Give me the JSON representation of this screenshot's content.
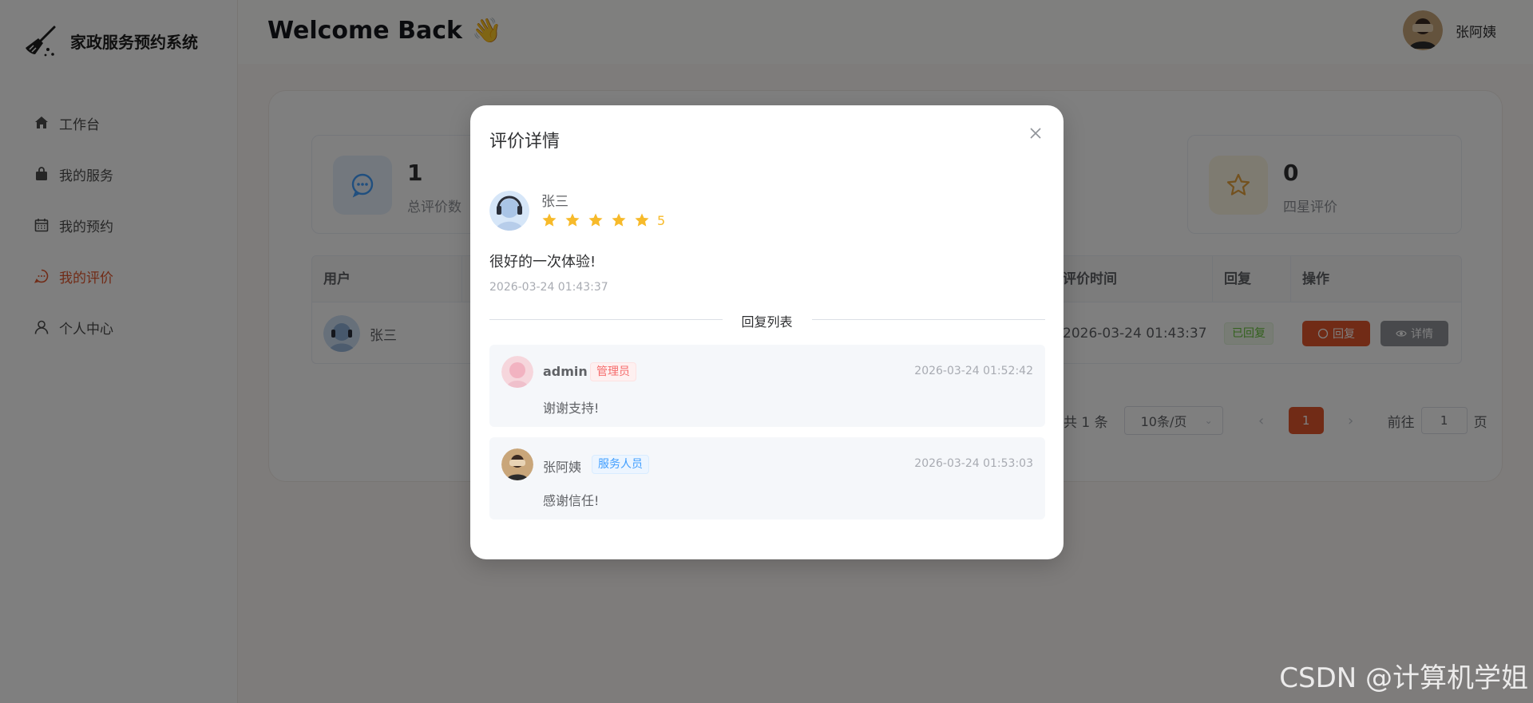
{
  "app": {
    "title": "家政服务预约系统",
    "logo_icon": "broom-icon"
  },
  "sidebar": {
    "items": [
      {
        "label": "工作台",
        "icon": "home-icon",
        "active": false
      },
      {
        "label": "我的服务",
        "icon": "bag-icon",
        "active": false
      },
      {
        "label": "我的预约",
        "icon": "calendar-icon",
        "active": false
      },
      {
        "label": "我的评价",
        "icon": "chat-icon",
        "active": true
      },
      {
        "label": "个人中心",
        "icon": "user-icon",
        "active": false
      }
    ]
  },
  "header": {
    "welcome": "Welcome Back",
    "wave": "👋",
    "user_name": "张阿姨"
  },
  "stats": [
    {
      "value": "1",
      "label": "总评价数",
      "icon": "comment-icon"
    },
    {
      "value": "0",
      "label": "四星评价",
      "icon": "star-outline-icon"
    }
  ],
  "table": {
    "columns": [
      "用户",
      "评价时间",
      "回复",
      "操作"
    ],
    "rows": [
      {
        "user": "张三",
        "time": "2026-03-24 01:43:37",
        "status": "已回复",
        "reply_btn": "回复",
        "detail_btn": "详情"
      }
    ]
  },
  "pagination": {
    "total": "共 1 条",
    "page_size": "10条/页",
    "current": "1",
    "goto_prefix": "前往",
    "goto_value": "1",
    "goto_suffix": "页"
  },
  "dialog": {
    "title": "评价详情",
    "review": {
      "user": "张三",
      "stars": 5,
      "score": "5",
      "content": "很好的一次体验!",
      "time": "2026-03-24 01:43:37"
    },
    "divider_label": "回复列表",
    "replies": [
      {
        "name": "admin",
        "role": "管理员",
        "time": "2026-03-24 01:52:42",
        "text": "谢谢支持!"
      },
      {
        "name": "张阿姨",
        "role": "服务人员",
        "time": "2026-03-24 01:53:03",
        "text": "感谢信任!"
      }
    ]
  },
  "colors": {
    "accent": "#e2562d",
    "star": "#f7ba2a",
    "success": "#67c23a",
    "admin_tag": "#f56c6c",
    "staff_tag": "#409eff"
  },
  "watermark": "CSDN @计算机学姐"
}
